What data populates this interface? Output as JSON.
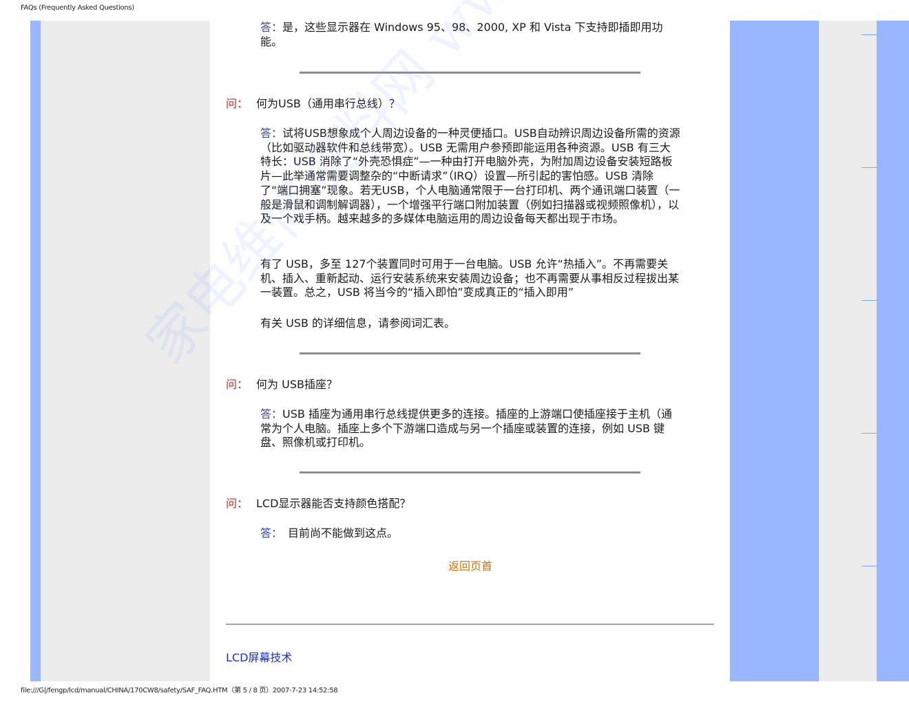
{
  "header": {
    "title": "FAQs (Frequently Asked Questions)"
  },
  "footer": {
    "path": "file:///G|/fengp/lcd/manual/CHINA/170CW8/safety/SAF_FAQ.HTM（第 5 / 8 页）2007-7-23 14:52:58"
  },
  "labels": {
    "answer": "答：",
    "question": "问："
  },
  "watermark": "家电维修资料网 www.520.com",
  "qa": {
    "intro_answer": "是，这些显示器在 Windows 95、98、2000, XP 和 Vista 下支持即插即用功能。",
    "q1": "何为USB（通用串行总线）？",
    "a1_p1": "试将USB想象成个人周边设备的一种灵便插口。USB自动辨识周边设备所需的资源（比如驱动器软件和总线带宽）。USB 无需用户参预即能运用各种资源。USB 有三大特长：USB 消除了“外壳恐惧症”—一种由打开电脑外壳，为附加周边设备安装短路板片—此举通常需要调整杂的“中断请求”（IRQ）设置—所引起的害怕感。USB 清除了“端口拥塞”现象。若无USB，个人电脑通常限于一台打印机、两个通讯端口装置（一般是滑鼠和调制解调器），一个增强平行端口附加装置（例如扫描器或视频照像机），以及一个戏手柄。越来越多的多媒体电脑运用的周边设备每天都出现于市场。",
    "a1_p2": "有了 USB，多至 127个装置同时可用于一台电脑。USB 允许“热插入”。不再需要关机、插入、重新起动、运行安装系统来安装周边设备；也不再需要从事相反过程拔出某一装置。总之，USB 将当今的“插入即怕”变成真正的“插入即用”",
    "a1_p3": "有关 USB 的详细信息，请参阅词汇表。",
    "q2": "何为 USB插座？",
    "a2": "USB 插座为通用串行总线提供更多的连接。插座的上游端口使插座接于主机（通常为个人电脑。插座上多个下游端口造成与另一个插座或装置的连接，例如 USB 键盘、照像机或打印机。",
    "q3": "LCD显示器能否支持颜色搭配？",
    "a3": "目前尚不能做到这点。"
  },
  "links": {
    "back_to_top": "返回页首",
    "section": "LCD屏幕技术"
  },
  "colors": {
    "frame_blue": "#99b7ff",
    "frame_gray": "#ececec",
    "answer_label": "#2b3fd8",
    "question_label": "#d42020",
    "back_link": "#e07000",
    "section_link": "#1a2fd8"
  }
}
